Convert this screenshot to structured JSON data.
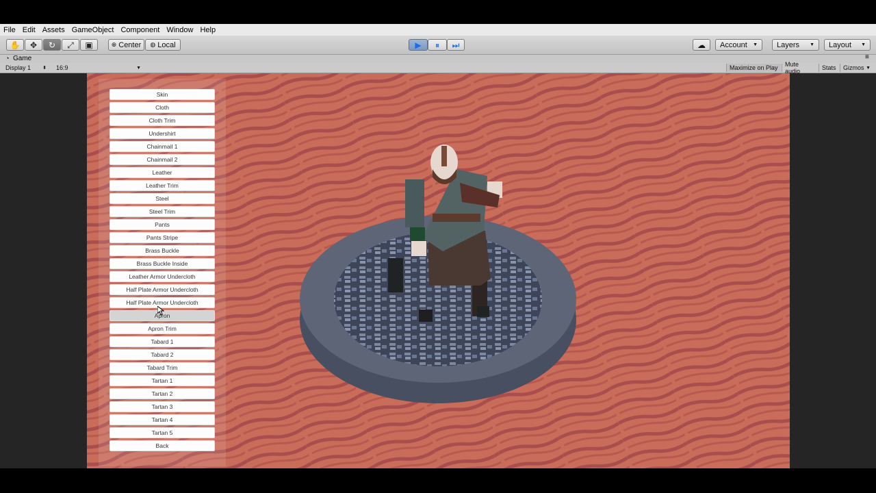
{
  "menu": [
    "File",
    "Edit",
    "Assets",
    "GameObject",
    "Component",
    "Window",
    "Help"
  ],
  "toolbar": {
    "tools": [
      {
        "name": "hand-tool-icon",
        "glyph": "✋"
      },
      {
        "name": "move-tool-icon",
        "glyph": "✥"
      },
      {
        "name": "rotate-tool-icon",
        "glyph": "↻"
      },
      {
        "name": "scale-tool-icon",
        "glyph": "⤢"
      },
      {
        "name": "rect-tool-icon",
        "glyph": "▣"
      }
    ],
    "pivot_label": "Center",
    "space_label": "Local",
    "play_glyph": "▶",
    "pause_glyph": "⏸",
    "step_glyph": "⏭",
    "account_label": "Account",
    "layers_label": "Layers",
    "layout_label": "Layout"
  },
  "tab": {
    "icon": "pac-man-icon",
    "label": "Game"
  },
  "game_bar": {
    "display": "Display 1",
    "aspect": "16:9",
    "maximize": "Maximize on Play",
    "mute": "Mute audio",
    "stats": "Stats",
    "gizmos": "Gizmos"
  },
  "colors": {
    "background": "#c96c59",
    "stripe": "#a94e4d",
    "platform_rim": "#555d6e",
    "platform_top": "#3e4558",
    "cobble": "#7c87a0"
  },
  "buttons": [
    "Skin",
    "Cloth",
    "Cloth Trim",
    "Undershirt",
    "Chainmail 1",
    "Chainmail 2",
    "Leather",
    "Leather Trim",
    "Steel",
    "Steel Trim",
    "Pants",
    "Pants Stripe",
    "Brass Buckle",
    "Brass Buckle Inside",
    "Leather Armor Undercloth",
    "Half Plate Armor Undercloth",
    "Half Plate Armor Undercloth",
    "Apron",
    "Apron Trim",
    "Tabard 1",
    "Tabard 2",
    "Tabard Trim",
    "Tartan 1",
    "Tartan 2",
    "Tartan 3",
    "Tartan 4",
    "Tartan 5",
    "Back"
  ],
  "hovered_button_index": 17
}
